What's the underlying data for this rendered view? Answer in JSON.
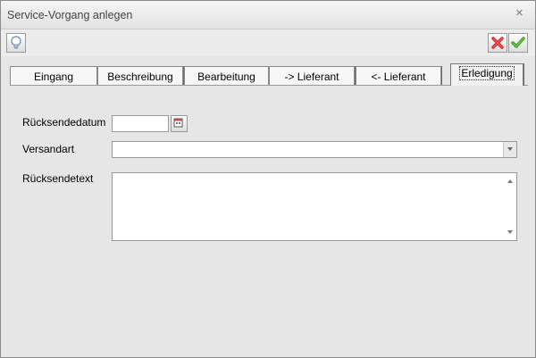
{
  "window": {
    "title": "Service-Vorgang anlegen",
    "close_glyph": "×"
  },
  "toolbar": {
    "hint_icon": "lightbulb-icon",
    "cancel_icon": "red-x-icon",
    "confirm_icon": "green-check-icon"
  },
  "tabs": [
    {
      "label": "Eingang"
    },
    {
      "label": "Beschreibung"
    },
    {
      "label": "Bearbeitung"
    },
    {
      "label": "-> Lieferant"
    },
    {
      "label": "<- Lieferant"
    },
    {
      "label": "Erledigung"
    }
  ],
  "active_tab": "Erledigung",
  "form": {
    "return_date_label": "Rücksendedatum",
    "return_date_value": "",
    "shipping_label": "Versandart",
    "shipping_value": "",
    "return_text_label": "Rücksendetext",
    "return_text_value": ""
  },
  "colors": {
    "cancel": "#d02020",
    "confirm": "#3a9a1a",
    "window_bg": "#e6e6e6"
  }
}
